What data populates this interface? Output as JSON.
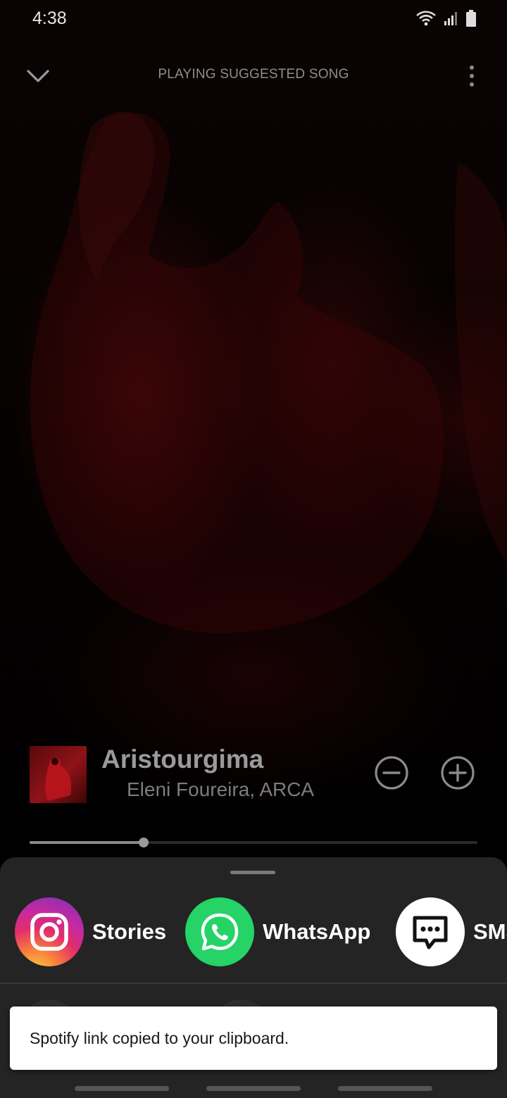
{
  "status_bar": {
    "time": "4:38",
    "icons": [
      "wifi-icon",
      "signal-icon",
      "battery-icon"
    ]
  },
  "header": {
    "collapse_icon": "chevron-down-icon",
    "context_title": "PLAYING SUGGESTED SONG",
    "more_icon": "more-vertical-icon"
  },
  "track": {
    "title": "Aristourgima",
    "artist": "Eleni Foureira, ARCA",
    "remove_icon": "minus-circle-icon",
    "add_icon": "plus-circle-icon",
    "progress_fraction": 0.254
  },
  "share_sheet": {
    "items": [
      {
        "label": "Stories",
        "icon": "instagram-icon"
      },
      {
        "label": "WhatsApp",
        "icon": "whatsapp-icon"
      },
      {
        "label": "SMS",
        "icon": "sms-icon"
      }
    ]
  },
  "toast": {
    "message": "Spotify link copied to your clipboard."
  },
  "colors": {
    "accent_whatsapp": "#25D366",
    "sheet_bg": "#242424",
    "toast_bg": "#FFFFFF"
  }
}
